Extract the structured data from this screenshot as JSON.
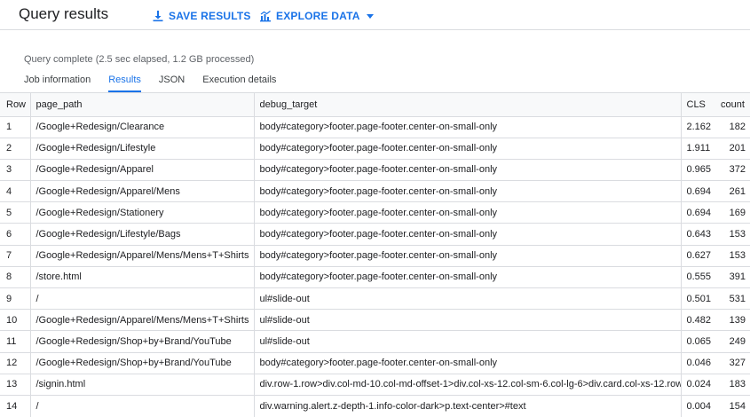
{
  "header": {
    "title": "Query results",
    "save_label": "SAVE RESULTS",
    "explore_label": "EXPLORE DATA",
    "save_icon": "download-icon",
    "explore_icon": "chart-icon",
    "explore_caret_icon": "caret-down-icon"
  },
  "status_text": "Query complete (2.5 sec elapsed, 1.2 GB processed)",
  "tabs": [
    {
      "label": "Job information",
      "active": false
    },
    {
      "label": "Results",
      "active": true
    },
    {
      "label": "JSON",
      "active": false
    },
    {
      "label": "Execution details",
      "active": false
    }
  ],
  "table": {
    "columns": [
      "Row",
      "page_path",
      "debug_target",
      "CLS",
      "count"
    ],
    "rows": [
      {
        "row": "1",
        "page_path": "/Google+Redesign/Clearance",
        "debug_target": "body#category>footer.page-footer.center-on-small-only",
        "cls": "2.162",
        "count": "182"
      },
      {
        "row": "2",
        "page_path": "/Google+Redesign/Lifestyle",
        "debug_target": "body#category>footer.page-footer.center-on-small-only",
        "cls": "1.911",
        "count": "201"
      },
      {
        "row": "3",
        "page_path": "/Google+Redesign/Apparel",
        "debug_target": "body#category>footer.page-footer.center-on-small-only",
        "cls": "0.965",
        "count": "372"
      },
      {
        "row": "4",
        "page_path": "/Google+Redesign/Apparel/Mens",
        "debug_target": "body#category>footer.page-footer.center-on-small-only",
        "cls": "0.694",
        "count": "261"
      },
      {
        "row": "5",
        "page_path": "/Google+Redesign/Stationery",
        "debug_target": "body#category>footer.page-footer.center-on-small-only",
        "cls": "0.694",
        "count": "169"
      },
      {
        "row": "6",
        "page_path": "/Google+Redesign/Lifestyle/Bags",
        "debug_target": "body#category>footer.page-footer.center-on-small-only",
        "cls": "0.643",
        "count": "153"
      },
      {
        "row": "7",
        "page_path": "/Google+Redesign/Apparel/Mens/Mens+T+Shirts",
        "debug_target": "body#category>footer.page-footer.center-on-small-only",
        "cls": "0.627",
        "count": "153"
      },
      {
        "row": "8",
        "page_path": "/store.html",
        "debug_target": "body#category>footer.page-footer.center-on-small-only",
        "cls": "0.555",
        "count": "391"
      },
      {
        "row": "9",
        "page_path": "/",
        "debug_target": "ul#slide-out",
        "cls": "0.501",
        "count": "531"
      },
      {
        "row": "10",
        "page_path": "/Google+Redesign/Apparel/Mens/Mens+T+Shirts",
        "debug_target": "ul#slide-out",
        "cls": "0.482",
        "count": "139"
      },
      {
        "row": "11",
        "page_path": "/Google+Redesign/Shop+by+Brand/YouTube",
        "debug_target": "ul#slide-out",
        "cls": "0.065",
        "count": "249"
      },
      {
        "row": "12",
        "page_path": "/Google+Redesign/Shop+by+Brand/YouTube",
        "debug_target": "body#category>footer.page-footer.center-on-small-only",
        "cls": "0.046",
        "count": "327"
      },
      {
        "row": "13",
        "page_path": "/signin.html",
        "debug_target": "div.row-1.row>div.col-md-10.col-md-offset-1>div.col-xs-12.col-sm-6.col-lg-6>div.card.col-xs-12.row",
        "cls": "0.024",
        "count": "183"
      },
      {
        "row": "14",
        "page_path": "/",
        "debug_target": "div.warning.alert.z-depth-1.info-color-dark>p.text-center>#text",
        "cls": "0.004",
        "count": "154"
      }
    ]
  },
  "colors": {
    "accent": "#1a73e8",
    "divider": "#dadce0",
    "header_bg": "#f8f9fa",
    "muted_text": "#5f6368"
  }
}
